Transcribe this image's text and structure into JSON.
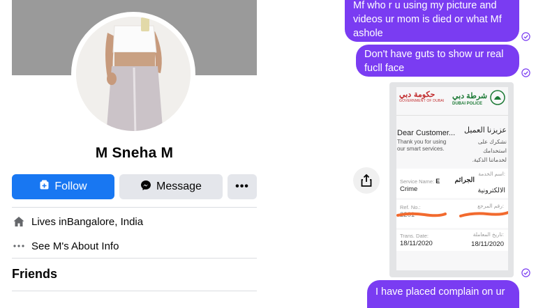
{
  "profile": {
    "name": "M Sneha M",
    "follow_label": "Follow",
    "message_label": "Message",
    "more_label": "•••",
    "lives_prefix": "Lives in ",
    "lives_place": "Bangalore, India",
    "about_label": "See M's About Info",
    "friends_heading": "Friends"
  },
  "chat": {
    "messages": [
      {
        "line1": "Mf who r u using my picture  and",
        "line2": "videos ur mom is died or what Mf",
        "line3": "ashole"
      },
      {
        "line1": "Don't have guts to show ur real",
        "line2": "fucll face"
      },
      {
        "line1": "I have placed complain on ur"
      }
    ],
    "bubble_color": "#7a3cf2"
  },
  "police_card": {
    "gov_ar": "حكومة دبي",
    "gov_en": "GOVERNMENT OF DUBAI",
    "police_ar": "شرطة دبي",
    "police_en": "DUBAI POLICE",
    "dear_en": "Dear Customer...",
    "thanks_en_1": "Thank you for using",
    "thanks_en_2": "our smart services.",
    "dear_ar": "عزيزنا العميل",
    "thanks_ar_1": "نشكرك على استخدامك",
    "thanks_ar_2": "لخدماتنا الذكية.",
    "service_label_en": "Service Name:",
    "service_value_en_1": "E",
    "service_value_en_2": "Crime",
    "service_label_ar": "اسم الخدمة:",
    "service_value_ar_1": "الجرائم",
    "service_value_ar_2": "الالكترونية",
    "ref_label_en": "Ref. No.:",
    "ref_label_ar": "رقم المرجع:",
    "ref_value_partial": "2201",
    "date_label_en": "Trans. Date:",
    "date_label_ar": "تاريخ المعاملة:",
    "date_value_en": "18/11/2020",
    "date_value_ar": "18/11/2020"
  },
  "colors": {
    "facebook_blue": "#1877f2",
    "button_gray": "#e4e6eb",
    "cover_gray": "#9a9a9a",
    "police_green": "#1d7a36",
    "gov_red": "#c0282a",
    "scribble_orange": "#f26a2e"
  }
}
